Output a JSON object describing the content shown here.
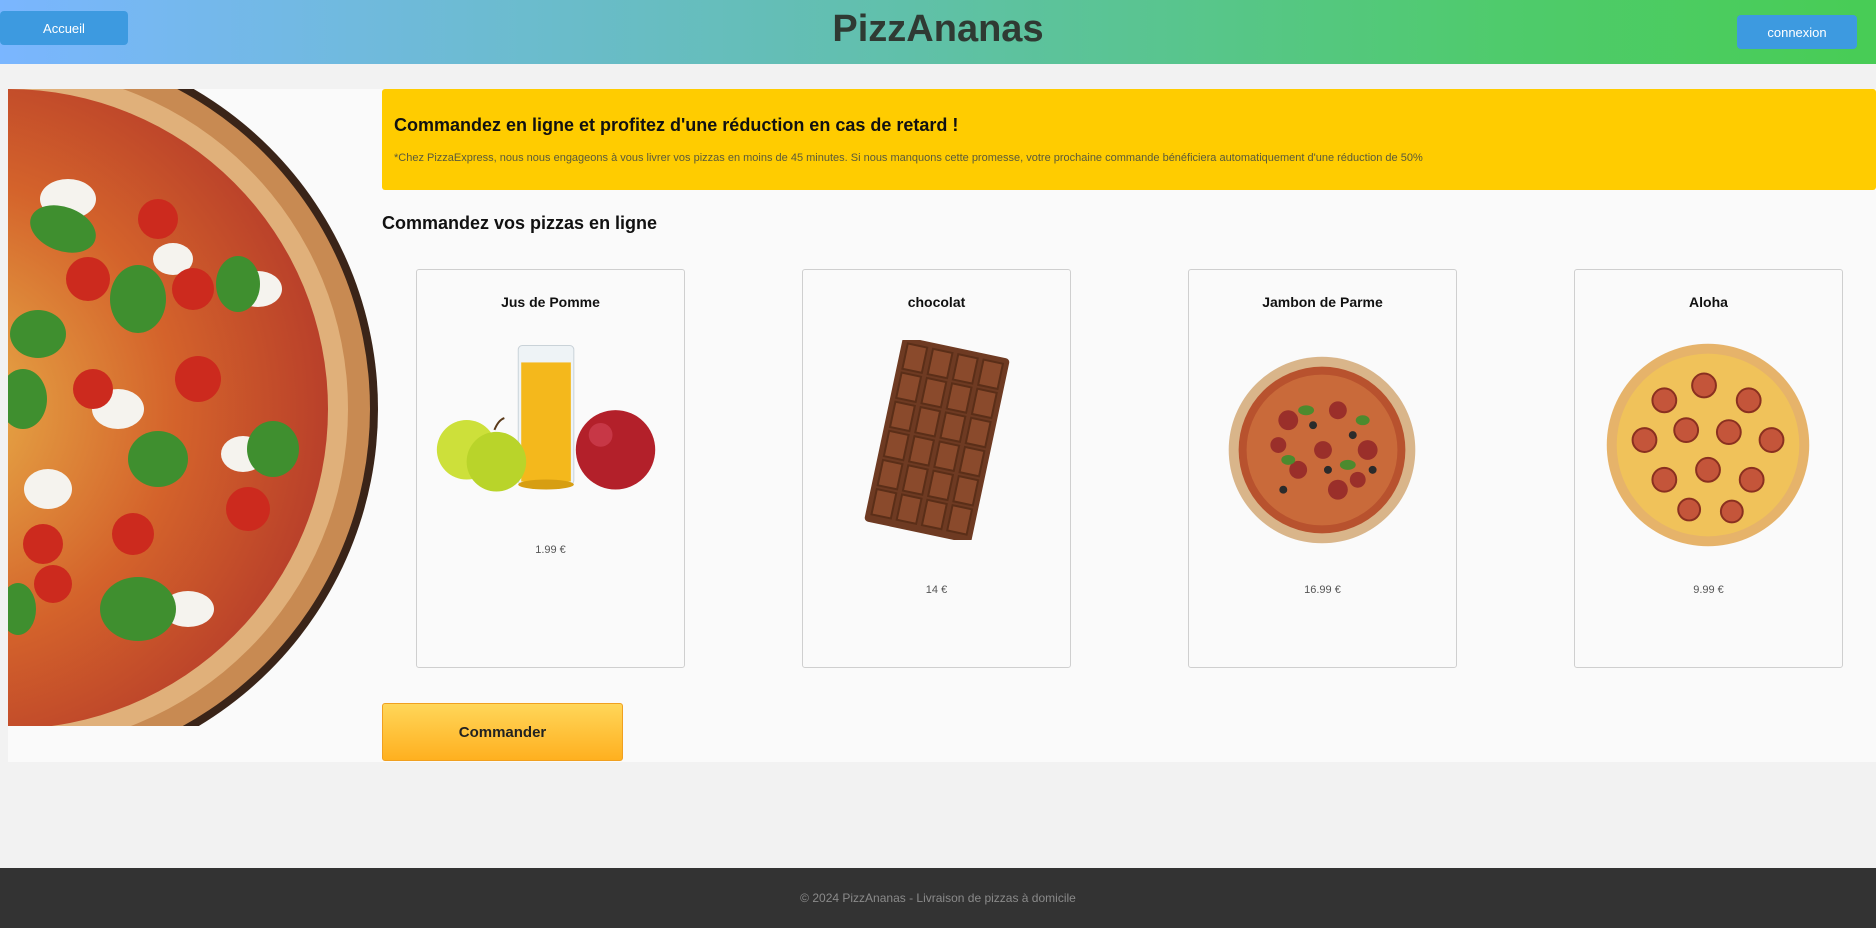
{
  "header": {
    "home_label": "Accueil",
    "site_title": "PizzAnanas",
    "login_label": "connexion"
  },
  "promo": {
    "title": "Commandez en ligne et profitez d'une réduction en cas de retard !",
    "text": "*Chez PizzaExpress, nous nous engageons à vous livrer vos pizzas en moins de 45 minutes. Si nous manquons cette promesse, votre prochaine commande bénéficiera automatiquement d'une réduction de 50%"
  },
  "section_title": "Commandez vos pizzas en ligne",
  "products": [
    {
      "name": "Jus de Pomme",
      "price": "1.99 €",
      "image": "apple-juice-image"
    },
    {
      "name": "chocolat",
      "price": "14 €",
      "image": "chocolate-bar-image"
    },
    {
      "name": "Jambon de Parme",
      "price": "16.99 €",
      "image": "pizza-parma-image"
    },
    {
      "name": "Aloha",
      "price": "9.99 €",
      "image": "pizza-aloha-image"
    }
  ],
  "order_label": "Commander",
  "footer_text": "© 2024 PizzAnanas - Livraison de pizzas à domicile",
  "colors": {
    "header_gradient_start": "#7ab6ff",
    "header_gradient_end": "#48cc55",
    "button_blue": "#3d9ae0",
    "promo_yellow": "#ffcc00",
    "order_button": "#ffb01f",
    "footer": "#333333"
  }
}
